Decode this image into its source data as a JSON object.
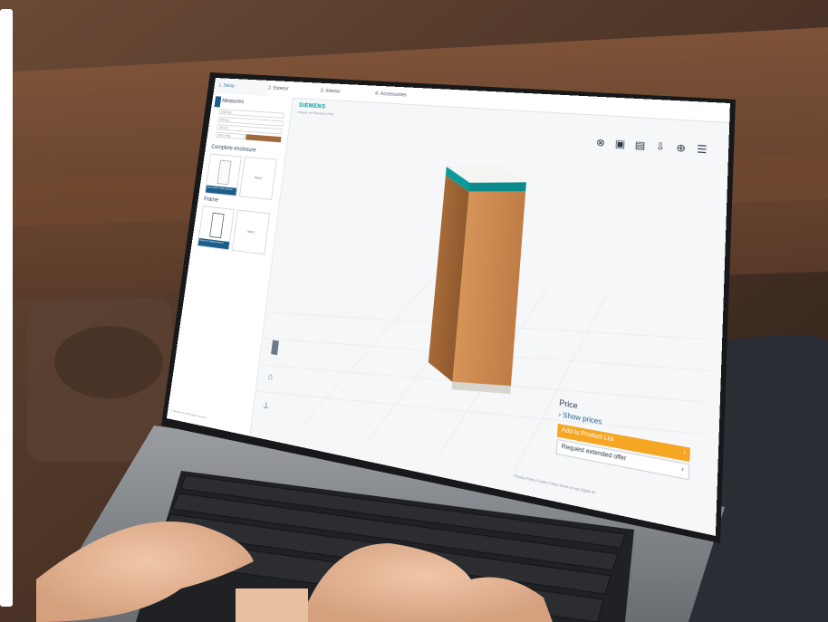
{
  "app": {
    "tabs": [
      {
        "label": "1. Setup",
        "active": true
      },
      {
        "label": "2. Exterior",
        "active": false
      },
      {
        "label": "3. Interior",
        "active": false
      },
      {
        "label": "4. Accessories",
        "active": false
      }
    ],
    "sidebar": {
      "measure_title": "Measures",
      "fields": [
        "2000 mm",
        "600 mm",
        "500 mm",
        "IP55 / IP54"
      ],
      "complete_enclosure_title": "Complete enclosure",
      "complete_caption": "Siemens 8MF single enclosure",
      "frame_title": "Frame",
      "frame_caption": "Frame for modular enclosure",
      "thumb_right_label": "Select"
    },
    "brand": "SIEMENS",
    "subtitle": "Degree of Protection IP55",
    "toolbar_icons": [
      "close-circle-icon",
      "open-folder-icon",
      "save-icon",
      "download-icon",
      "globe-icon",
      "list-icon"
    ],
    "price": {
      "label": "Price",
      "show_prices": "Show prices",
      "add_button": "Add to Product List",
      "request_button": "Request extended offer"
    },
    "footer_links": "Privacy Policy    Cookie Policy    Terms of use    Digital ID",
    "copyright": "© Siemens AG 2019 Right reserved"
  },
  "colors": {
    "accent": "#009999",
    "orange_button": "#f5a623",
    "cabinet": "#c8874f"
  }
}
